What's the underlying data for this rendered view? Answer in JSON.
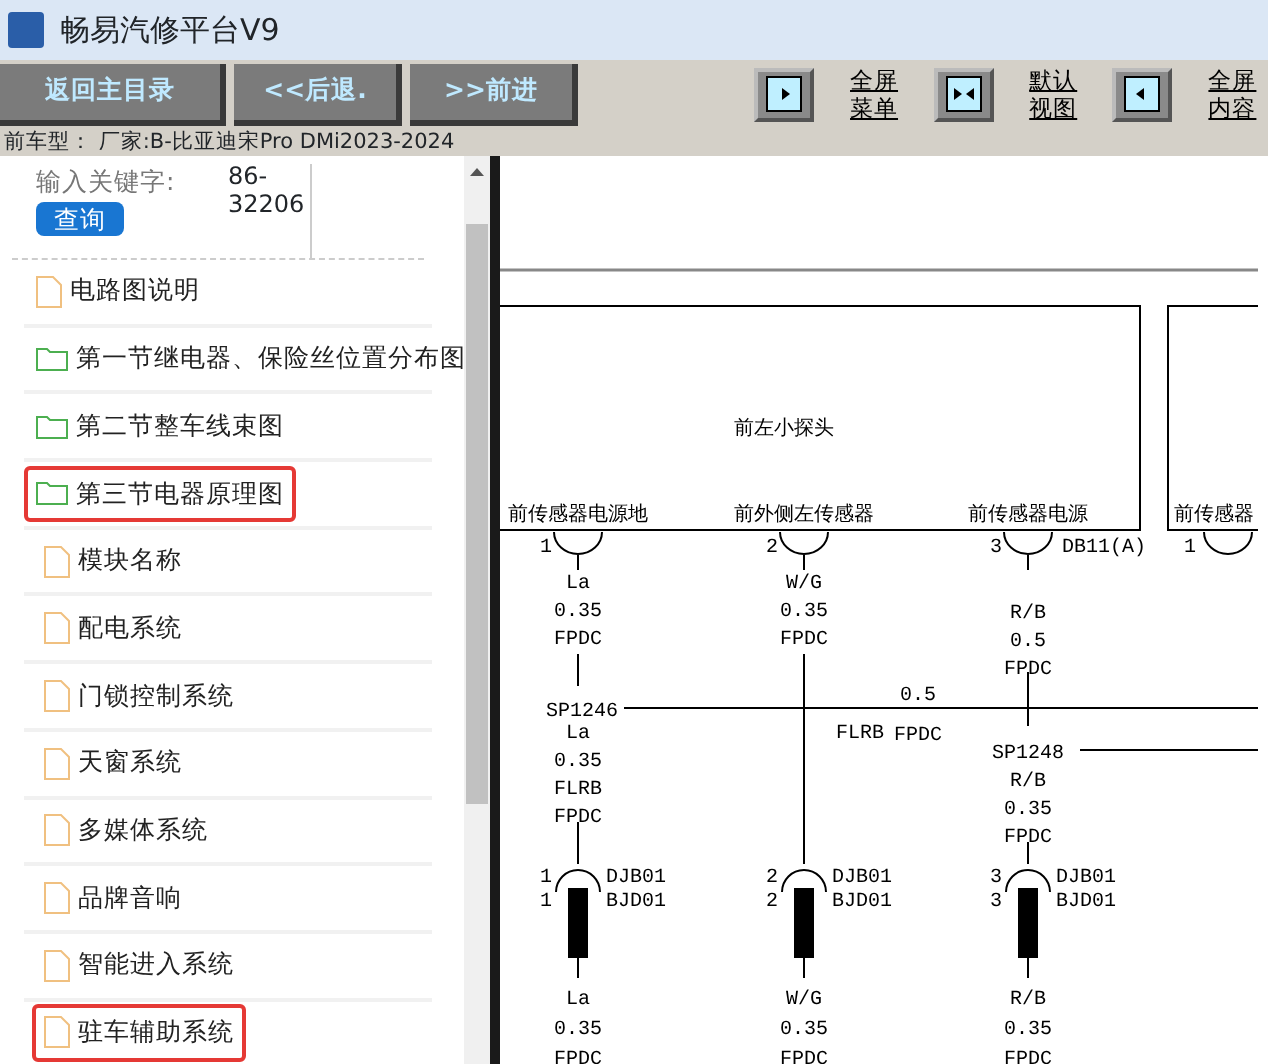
{
  "window": {
    "title": "畅易汽修平台V9"
  },
  "toolbar": {
    "buttons": [
      "返回主目录",
      "<<后退.",
      ">>前进"
    ],
    "view_buttons": [
      {
        "kind": "right",
        "label": "全屏菜单"
      },
      {
        "kind": "both",
        "label": "默认视图"
      },
      {
        "kind": "left",
        "label": "全屏内容"
      }
    ]
  },
  "vehicle_line": "前车型： 厂家:B-比亚迪宋Pro DMi2023-2024",
  "search": {
    "label": "输入关键字:",
    "value": "86-32206",
    "button": "查询"
  },
  "tree": [
    {
      "kind": "file",
      "label": "电路图说明",
      "highlighted": false
    },
    {
      "kind": "folder",
      "label": "第一节继电器、保险丝位置分布图",
      "highlighted": false
    },
    {
      "kind": "folder",
      "label": "第二节整车线束图",
      "highlighted": false
    },
    {
      "kind": "folder",
      "label": "第三节电器原理图",
      "highlighted": true,
      "children": [
        {
          "kind": "file",
          "label": "模块名称",
          "highlighted": false
        },
        {
          "kind": "file",
          "label": "配电系统",
          "highlighted": false
        },
        {
          "kind": "file",
          "label": "门锁控制系统",
          "highlighted": false
        },
        {
          "kind": "file",
          "label": "天窗系统",
          "highlighted": false
        },
        {
          "kind": "file",
          "label": "多媒体系统",
          "highlighted": false
        },
        {
          "kind": "file",
          "label": "品牌音响",
          "highlighted": false
        },
        {
          "kind": "file",
          "label": "智能进入系统",
          "highlighted": false
        },
        {
          "kind": "file",
          "label": "驻车辅助系统",
          "highlighted": true
        }
      ]
    }
  ],
  "diagram": {
    "module_name": "前左小探头",
    "connector_code": "DB11(A)",
    "junction_wire": [
      "0.5",
      "FPDC"
    ],
    "pins": [
      {
        "label": "前传感器电源地",
        "number": "1",
        "upper_wire": [
          "La",
          "0.35",
          "FPDC"
        ],
        "splice": "SP1246",
        "lower_wire": [
          "La",
          "0.35",
          "FLRB",
          "FPDC"
        ],
        "inline_pins": [
          "1",
          "1"
        ],
        "inline_codes": [
          "DJB01",
          "BJD01"
        ],
        "bottom_wire": [
          "La",
          "0.35",
          "FPDC"
        ]
      },
      {
        "label": "前外侧左传感器",
        "number": "2",
        "upper_wire": [
          "W/G",
          "0.35",
          "FPDC"
        ],
        "junction_label": "FLRB",
        "inline_pins": [
          "2",
          "2"
        ],
        "inline_codes": [
          "DJB01",
          "BJD01"
        ],
        "bottom_wire": [
          "W/G",
          "0.35",
          "FPDC"
        ]
      },
      {
        "label": "前传感器电源",
        "number": "3",
        "upper_wire": [
          "R/B",
          "0.5",
          "FPDC"
        ],
        "splice": "SP1248",
        "lower_wire": [
          "R/B",
          "0.35",
          "FPDC"
        ],
        "inline_pins": [
          "3",
          "3"
        ],
        "inline_codes": [
          "DJB01",
          "BJD01"
        ],
        "bottom_wire": [
          "R/B",
          "0.35",
          "FPDC"
        ]
      }
    ],
    "next_module": {
      "pin_label": "前传感器",
      "number": "1"
    }
  }
}
